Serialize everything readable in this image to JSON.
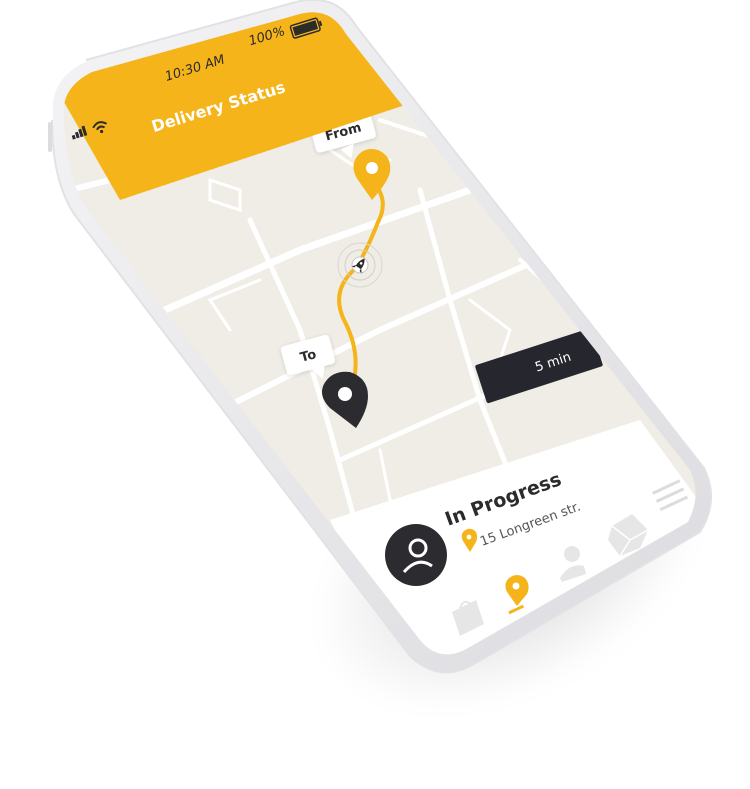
{
  "status_bar": {
    "time": "10:30 AM",
    "battery": "100%",
    "signal_icon": "signal-bars-icon",
    "wifi_icon": "wifi-icon",
    "battery_icon": "battery-icon"
  },
  "header": {
    "title": "Delivery Status",
    "color": "#F5B41A"
  },
  "map": {
    "from_label": "From",
    "to_label": "To",
    "eta": "5 min",
    "route_color": "#F5B41A",
    "courier_icon": "rocket-icon",
    "from_pin_icon": "location-pin-icon",
    "to_pin_icon": "location-pin-icon"
  },
  "delivery": {
    "status": "In Progress",
    "address": "15 Longreen str.",
    "avatar_icon": "user-avatar-icon",
    "menu_icon": "menu-icon"
  },
  "bottom_nav": {
    "items": [
      {
        "icon": "shopping-bag-icon"
      },
      {
        "icon": "location-pin-icon",
        "active": true
      },
      {
        "icon": "user-icon"
      },
      {
        "icon": "package-icon"
      }
    ]
  }
}
